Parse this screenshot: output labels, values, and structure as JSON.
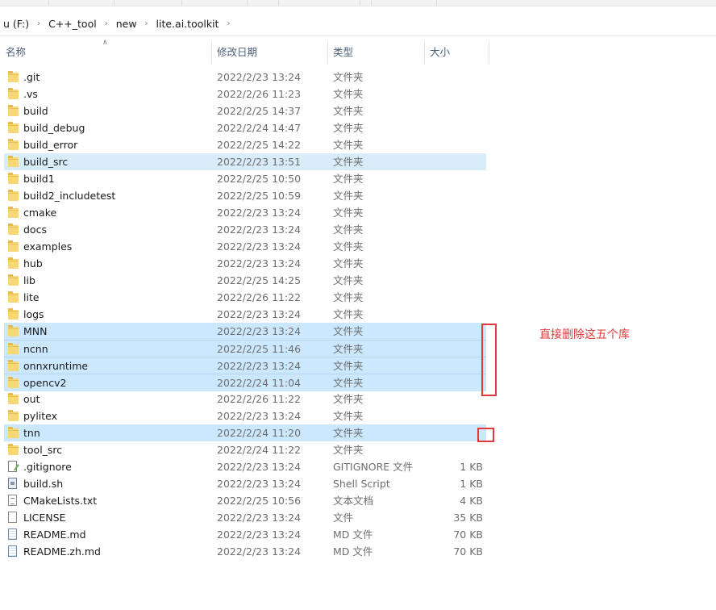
{
  "breadcrumb": [
    "u (F:)",
    "C++_tool",
    "new",
    "lite.ai.toolkit"
  ],
  "columns": {
    "name": "名称",
    "date": "修改日期",
    "type": "类型",
    "size": "大小"
  },
  "files": [
    {
      "name": ".git",
      "date": "2022/2/23 13:24",
      "type": "文件夹",
      "size": "",
      "icon": "folder-icon",
      "selected": false
    },
    {
      "name": ".vs",
      "date": "2022/2/26 11:23",
      "type": "文件夹",
      "size": "",
      "icon": "folder-icon",
      "selected": false
    },
    {
      "name": "build",
      "date": "2022/2/25 14:37",
      "type": "文件夹",
      "size": "",
      "icon": "folder-icon",
      "selected": false
    },
    {
      "name": "build_debug",
      "date": "2022/2/24 14:47",
      "type": "文件夹",
      "size": "",
      "icon": "folder-icon",
      "selected": false
    },
    {
      "name": "build_error",
      "date": "2022/2/25 14:22",
      "type": "文件夹",
      "size": "",
      "icon": "folder-icon",
      "selected": false
    },
    {
      "name": "build_src",
      "date": "2022/2/23 13:51",
      "type": "文件夹",
      "size": "",
      "icon": "folder-icon",
      "selected": true,
      "hover": true
    },
    {
      "name": "build1",
      "date": "2022/2/25 10:50",
      "type": "文件夹",
      "size": "",
      "icon": "folder-icon",
      "selected": false
    },
    {
      "name": "build2_includetest",
      "date": "2022/2/25 10:59",
      "type": "文件夹",
      "size": "",
      "icon": "folder-icon",
      "selected": false
    },
    {
      "name": "cmake",
      "date": "2022/2/23 13:24",
      "type": "文件夹",
      "size": "",
      "icon": "folder-icon",
      "selected": false
    },
    {
      "name": "docs",
      "date": "2022/2/23 13:24",
      "type": "文件夹",
      "size": "",
      "icon": "folder-icon",
      "selected": false
    },
    {
      "name": "examples",
      "date": "2022/2/23 13:24",
      "type": "文件夹",
      "size": "",
      "icon": "folder-icon",
      "selected": false
    },
    {
      "name": "hub",
      "date": "2022/2/23 13:24",
      "type": "文件夹",
      "size": "",
      "icon": "folder-icon",
      "selected": false
    },
    {
      "name": "lib",
      "date": "2022/2/25 14:25",
      "type": "文件夹",
      "size": "",
      "icon": "folder-icon",
      "selected": false
    },
    {
      "name": "lite",
      "date": "2022/2/26 11:22",
      "type": "文件夹",
      "size": "",
      "icon": "folder-icon",
      "selected": false
    },
    {
      "name": "logs",
      "date": "2022/2/23 13:24",
      "type": "文件夹",
      "size": "",
      "icon": "folder-icon",
      "selected": false
    },
    {
      "name": "MNN",
      "date": "2022/2/23 13:24",
      "type": "文件夹",
      "size": "",
      "icon": "folder-icon",
      "selected": true
    },
    {
      "name": "ncnn",
      "date": "2022/2/25 11:46",
      "type": "文件夹",
      "size": "",
      "icon": "folder-icon",
      "selected": true
    },
    {
      "name": "onnxruntime",
      "date": "2022/2/23 13:24",
      "type": "文件夹",
      "size": "",
      "icon": "folder-icon",
      "selected": true
    },
    {
      "name": "opencv2",
      "date": "2022/2/24 11:04",
      "type": "文件夹",
      "size": "",
      "icon": "folder-icon",
      "selected": true
    },
    {
      "name": "out",
      "date": "2022/2/26 11:22",
      "type": "文件夹",
      "size": "",
      "icon": "folder-icon",
      "selected": false
    },
    {
      "name": "pylitex",
      "date": "2022/2/23 13:24",
      "type": "文件夹",
      "size": "",
      "icon": "folder-icon",
      "selected": false
    },
    {
      "name": "tnn",
      "date": "2022/2/24 11:20",
      "type": "文件夹",
      "size": "",
      "icon": "folder-icon",
      "selected": true
    },
    {
      "name": "tool_src",
      "date": "2022/2/24 11:22",
      "type": "文件夹",
      "size": "",
      "icon": "folder-icon",
      "selected": false
    },
    {
      "name": ".gitignore",
      "date": "2022/2/23 13:24",
      "type": "GITIGNORE 文件",
      "size": "1 KB",
      "icon": "gitignore-file-icon",
      "selected": false
    },
    {
      "name": "build.sh",
      "date": "2022/2/23 13:24",
      "type": "Shell Script",
      "size": "1 KB",
      "icon": "shell-script-icon",
      "selected": false
    },
    {
      "name": "CMakeLists.txt",
      "date": "2022/2/25 10:56",
      "type": "文本文档",
      "size": "4 KB",
      "icon": "text-file-icon",
      "selected": false
    },
    {
      "name": "LICENSE",
      "date": "2022/2/23 13:24",
      "type": "文件",
      "size": "35 KB",
      "icon": "file-icon",
      "selected": false
    },
    {
      "name": "README.md",
      "date": "2022/2/23 13:24",
      "type": "MD 文件",
      "size": "70 KB",
      "icon": "markdown-file-icon",
      "selected": false
    },
    {
      "name": "README.zh.md",
      "date": "2022/2/23 13:24",
      "type": "MD 文件",
      "size": "70 KB",
      "icon": "markdown-file-icon",
      "selected": false
    }
  ],
  "annotation": {
    "text": "直接删除这五个库",
    "color": "#e23a3a"
  },
  "colors": {
    "selected_row": "#cce8ff",
    "header_text": "#4c607a",
    "folder": "#f8d775"
  }
}
